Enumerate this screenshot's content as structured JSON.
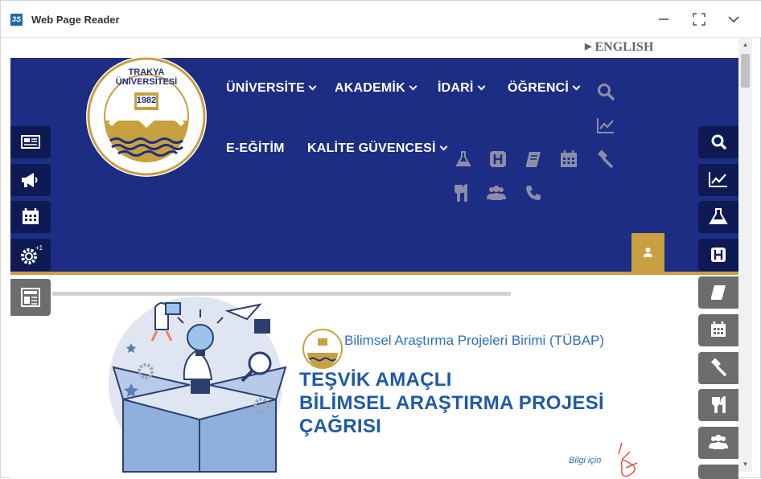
{
  "window": {
    "title": "Web Page Reader"
  },
  "page": {
    "language_link": "ENGLISH",
    "logo": {
      "university_name": "TRAKYA ÜNİVERSİTESİ",
      "year": "1982"
    },
    "nav": {
      "row1": [
        {
          "label": "ÜNİVERSİTE"
        },
        {
          "label": "AKADEMİK"
        },
        {
          "label": "İDARİ"
        },
        {
          "label": "ÖĞRENCİ"
        }
      ],
      "row2": [
        {
          "label": "E-EĞİTİM"
        },
        {
          "label": "KALİTE GÜVENCESİ"
        }
      ]
    },
    "header_icons": [
      "search-icon",
      "chart-line-icon",
      "flask-icon",
      "hospital-icon",
      "book-icon",
      "calendar-icon",
      "gavel-icon",
      "utensils-icon",
      "users-icon",
      "phone-icon"
    ],
    "left_sidebar": [
      "newspaper-icon",
      "megaphone-icon",
      "calendar-icon",
      "gear-icon",
      "news-icon"
    ],
    "right_sidebar": [
      "search-icon",
      "chart-line-icon",
      "flask-icon",
      "hospital-icon",
      "book-icon",
      "calendar-icon",
      "gavel-icon",
      "utensils-icon",
      "users-icon"
    ],
    "banner": {
      "subtitle": "Bilimsel Araştırma Projeleri Birimi (TÜBAP)",
      "headline_lines": [
        "TEŞVİK AMAÇLI",
        "BİLİMSEL ARAŞTIRMA PROJESİ",
        "ÇAĞRISI"
      ],
      "more_info": "Bilgi için"
    },
    "colors": {
      "header_blue": "#1d2d83",
      "gold": "#c9a03f",
      "sidebar_dark": "#0e1a54",
      "sidebar_grey": "#6d6d6d"
    }
  }
}
